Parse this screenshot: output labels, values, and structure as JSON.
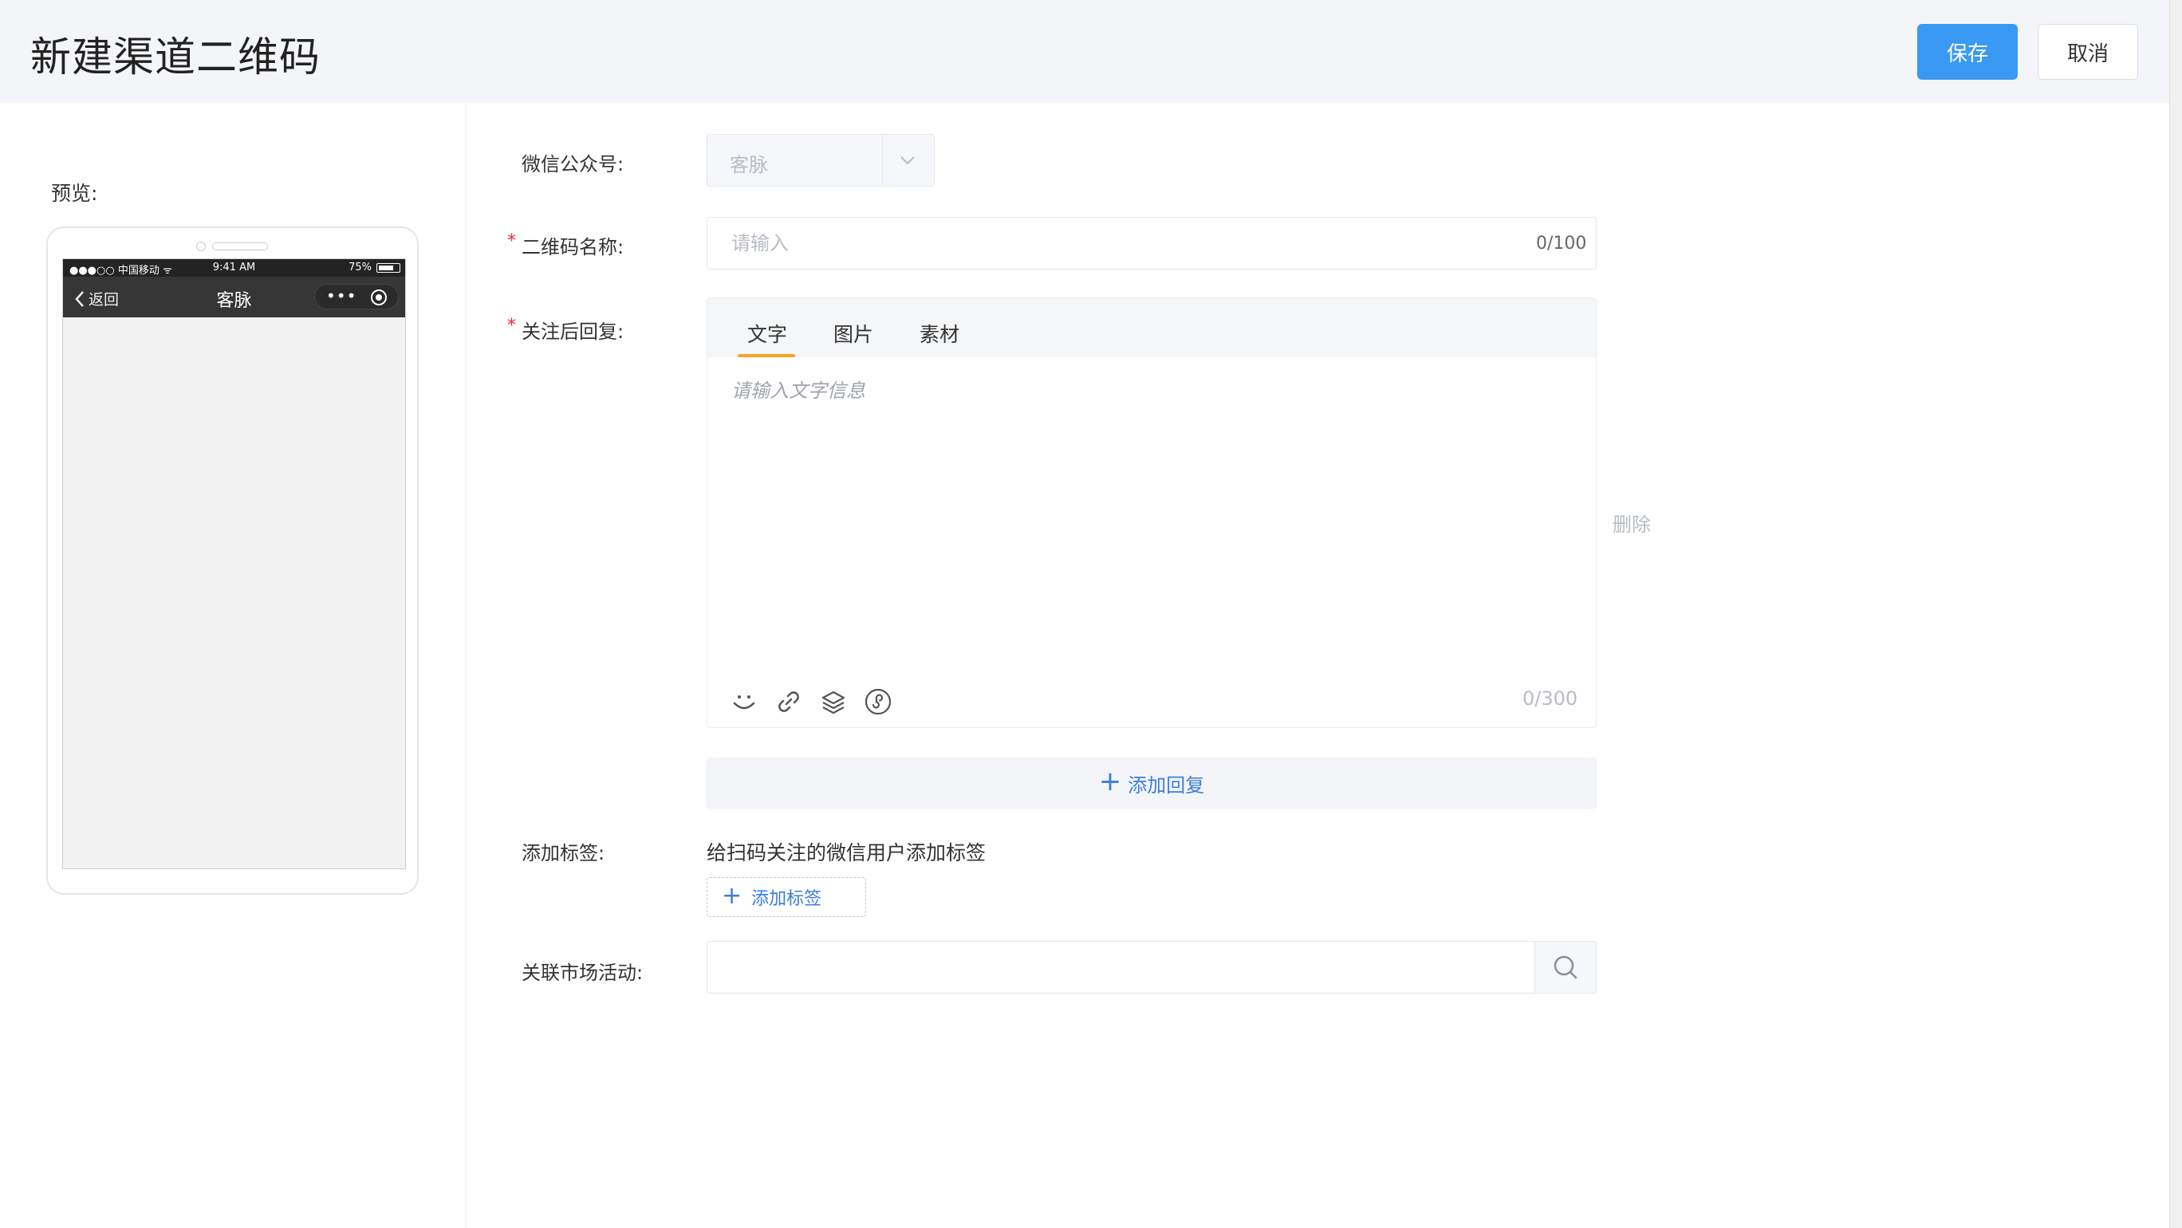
{
  "header": {
    "title": "新建渠道二维码",
    "save_label": "保存",
    "cancel_label": "取消"
  },
  "preview": {
    "label": "预览:",
    "status_bar": {
      "carrier": "●●●○○ 中国移动 ᯤ",
      "time": "9:41 AM",
      "battery": "75%"
    },
    "nav": {
      "back_label": "返回",
      "title": "客脉",
      "more": "•••"
    }
  },
  "form": {
    "account": {
      "label": "微信公众号:",
      "value": "客脉"
    },
    "qr_name": {
      "label": "二维码名称:",
      "placeholder": "请输入",
      "count": "0/100",
      "required_mark": "*"
    },
    "reply": {
      "label": "关注后回复:",
      "required_mark": "*",
      "tabs": [
        "文字",
        "图片",
        "素材"
      ],
      "active_tab": "文字",
      "placeholder": "请输入文字信息",
      "count": "0/300",
      "tools": [
        "emoji-icon",
        "link-icon",
        "layers-icon",
        "mini-program-icon"
      ],
      "delete_label": "删除",
      "add_reply_label": "添加回复"
    },
    "tags": {
      "label": "添加标签:",
      "description": "给扫码关注的微信用户添加标签",
      "add_label": "添加标签"
    },
    "activity": {
      "label": "关联市场活动:"
    }
  },
  "colors": {
    "primary": "#3a99f2",
    "link": "#3a7dde",
    "tab_underline": "#f5a623",
    "required": "#f5222d"
  }
}
